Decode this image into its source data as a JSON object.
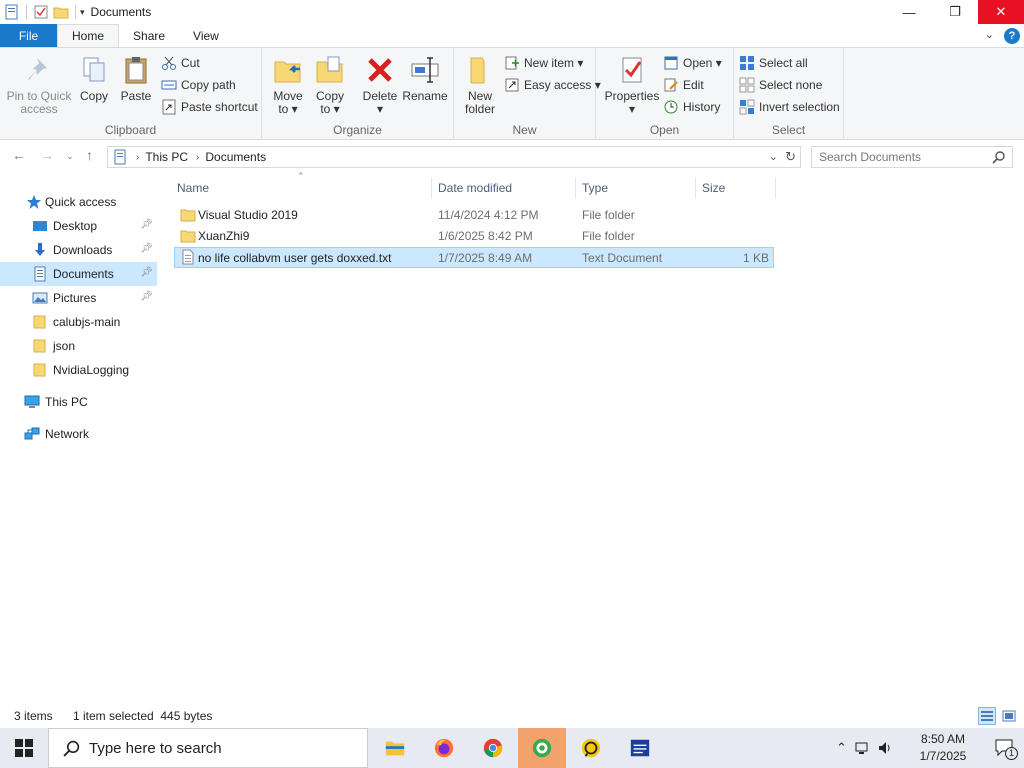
{
  "window": {
    "title": "Documents",
    "buttons": {
      "minimize": "—",
      "maximize": "❐",
      "close": "✕"
    }
  },
  "ribbon_tabs": [
    "File",
    "Home",
    "Share",
    "View"
  ],
  "ribbon": {
    "clipboard": {
      "label": "Clipboard",
      "pin_line1": "Pin to Quick",
      "pin_line2": "access",
      "copy": "Copy",
      "paste": "Paste",
      "cut": "Cut",
      "copy_path": "Copy path",
      "paste_shortcut": "Paste shortcut"
    },
    "organize": {
      "label": "Organize",
      "move_line1": "Move",
      "move_line2": "to ▾",
      "copy_line1": "Copy",
      "copy_line2": "to ▾",
      "delete_line1": "Delete",
      "delete_line2": "▾",
      "rename": "Rename"
    },
    "new": {
      "label": "New",
      "new_line1": "New",
      "new_line2": "folder",
      "new_item": "New item ▾",
      "easy_access": "Easy access ▾"
    },
    "open": {
      "label": "Open",
      "properties_line1": "Properties",
      "properties_line2": "▾",
      "open": "Open ▾",
      "edit": "Edit",
      "history": "History"
    },
    "select": {
      "label": "Select",
      "select_all": "Select all",
      "select_none": "Select none",
      "invert": "Invert selection"
    }
  },
  "address": {
    "crumbs": [
      "This PC",
      "Documents"
    ],
    "search_placeholder": "Search Documents"
  },
  "sidebar": {
    "items": [
      {
        "label": "Quick access",
        "icon": "star-icon"
      },
      {
        "label": "Desktop",
        "icon": "desktop-icon",
        "pinned": true
      },
      {
        "label": "Downloads",
        "icon": "downloads-icon",
        "pinned": true
      },
      {
        "label": "Documents",
        "icon": "documents-icon",
        "pinned": true,
        "selected": true
      },
      {
        "label": "Pictures",
        "icon": "pictures-icon",
        "pinned": true
      },
      {
        "label": "calubjs-main",
        "icon": "folder-icon"
      },
      {
        "label": "json",
        "icon": "folder-icon"
      },
      {
        "label": "NvidiaLogging",
        "icon": "folder-icon"
      },
      {
        "label": "This PC",
        "icon": "computer-icon"
      },
      {
        "label": "Network",
        "icon": "network-icon"
      }
    ]
  },
  "filelist": {
    "columns": [
      "Name",
      "Date modified",
      "Type",
      "Size"
    ],
    "rows": [
      {
        "name": "Visual Studio 2019",
        "date": "11/4/2024 4:12 PM",
        "type": "File folder",
        "size": "",
        "icon": "folder-icon"
      },
      {
        "name": "XuanZhi9",
        "date": "1/6/2025 8:42 PM",
        "type": "File folder",
        "size": "",
        "icon": "folder-icon"
      },
      {
        "name": "no life collabvm user gets doxxed.txt",
        "date": "1/7/2025 8:49 AM",
        "type": "Text Document",
        "size": "1 KB",
        "icon": "text-file-icon",
        "selected": true
      }
    ]
  },
  "status": {
    "items": "3 items",
    "selected": "1 item selected  445 bytes"
  },
  "taskbar": {
    "search_placeholder": "Type here to search",
    "time": "8:50 AM",
    "date": "1/7/2025",
    "notification_count": "1"
  },
  "colors": {
    "accent": "#1979ca",
    "selection": "#cce8ff",
    "close": "#e81123",
    "folder": "#f8d775",
    "taskbar_active": "#f2a36b"
  }
}
